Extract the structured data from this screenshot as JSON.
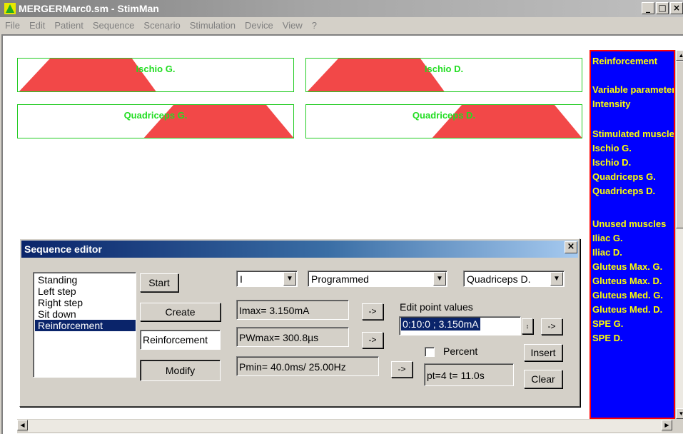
{
  "window": {
    "title": "MERGERMarc0.sm - StimMan",
    "controls": [
      "_",
      "□",
      "×"
    ]
  },
  "menu": [
    "File",
    "Edit",
    "Patient",
    "Sequence",
    "Scenario",
    "Stimulation",
    "Device",
    "View",
    "?"
  ],
  "muscles": [
    {
      "label": "Ischio G."
    },
    {
      "label": "Ischio D."
    },
    {
      "label": "Quadriceps G."
    },
    {
      "label": "Quadriceps D."
    }
  ],
  "colors": {
    "ramp_fill": "#f24848",
    "box_border": "#22cc22",
    "label": "#22dd22",
    "panel_bg": "#0000ff",
    "panel_text": "#ffff00"
  },
  "info_panel": {
    "lines": [
      "Reinforcement",
      "",
      "Variable parameter",
      "Intensity",
      "",
      "Stimulated muscles",
      "Ischio G.",
      "Ischio D.",
      "Quadriceps G.",
      "Quadriceps D.",
      "",
      "Unused muscles",
      "Iliac G.",
      "Iliac D.",
      "Gluteus Max. G.",
      "Gluteus Max. D.",
      "Gluteus Med. G.",
      "Gluteus Med. D.",
      "SPE G.",
      "SPE D."
    ]
  },
  "editor": {
    "title": "Sequence editor",
    "close": "×",
    "sequences": [
      "Standing",
      "Left step",
      "Right step",
      "Sit down",
      "Reinforcement"
    ],
    "selected_sequence": "Reinforcement",
    "start_label": "Start",
    "create_label": "Create",
    "name_value": "Reinforcement",
    "modify_label": "Modify",
    "param_select": "I",
    "mode_select": "Programmed",
    "muscle_select": "Quadriceps D.",
    "imax": "Imax=  3.150mA",
    "pwmax": "PWmax= 300.8µs",
    "pmin": "Pmin=  40.0ms/ 25.00Hz",
    "arrow": "->",
    "edit_label": "Edit point values",
    "point_value": "0:10:0 ;  3.150mA",
    "percent_label": "Percent",
    "insert_label": "Insert",
    "point_info": "pt=4 t= 11.0s",
    "clear_label": "Clear"
  }
}
